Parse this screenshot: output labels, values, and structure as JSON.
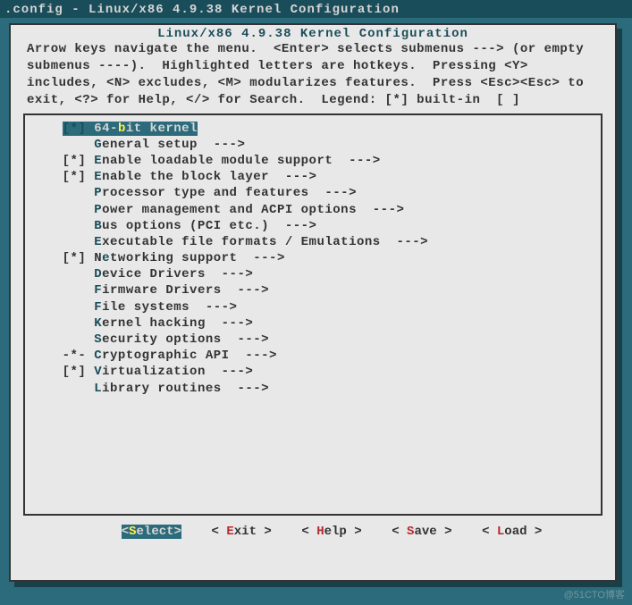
{
  "titlebar": ".config - Linux/x86 4.9.38 Kernel Configuration",
  "dialogTitle": "Linux/x86 4.9.38 Kernel Configuration",
  "help": {
    "l1": "Arrow keys navigate the menu.  <Enter> selects submenus ---> (or empty",
    "l2": "submenus ----).  Highlighted letters are hotkeys.  Pressing <Y>",
    "l3": "includes, <N> excludes, <M> modularizes features.  Press <Esc><Esc> to",
    "l4": "exit, <?> for Help, </> for Search.  Legend: [*] built-in  [ ]"
  },
  "menu": {
    "items": [
      {
        "marker": "[*]",
        "pre": "64-",
        "hot": "b",
        "post": "it kernel",
        "arrow": "",
        "selected": true
      },
      {
        "marker": "   ",
        "pre": "",
        "hot": "G",
        "post": "eneral setup  --->",
        "arrow": "",
        "selected": false
      },
      {
        "marker": "[*]",
        "pre": "",
        "hot": "E",
        "post": "nable loadable module support  --->",
        "arrow": "",
        "selected": false
      },
      {
        "marker": "[*]",
        "pre": "",
        "hot": "E",
        "post": "nable the block layer  --->",
        "arrow": "",
        "selected": false
      },
      {
        "marker": "   ",
        "pre": "",
        "hot": "P",
        "post": "rocessor type and features  --->",
        "arrow": "",
        "selected": false
      },
      {
        "marker": "   ",
        "pre": "",
        "hot": "P",
        "post": "ower management and ACPI options  --->",
        "arrow": "",
        "selected": false
      },
      {
        "marker": "   ",
        "pre": "",
        "hot": "B",
        "post": "us options (PCI etc.)  --->",
        "arrow": "",
        "selected": false
      },
      {
        "marker": "   ",
        "pre": "",
        "hot": "E",
        "post": "xecutable file formats / Emulations  --->",
        "arrow": "",
        "selected": false
      },
      {
        "marker": "[*]",
        "pre": "N",
        "hot": "e",
        "post": "tworking support  --->",
        "arrow": "",
        "selected": false
      },
      {
        "marker": "   ",
        "pre": "",
        "hot": "D",
        "post": "evice Drivers  --->",
        "arrow": "",
        "selected": false
      },
      {
        "marker": "   ",
        "pre": "",
        "hot": "F",
        "post": "irmware Drivers  --->",
        "arrow": "",
        "selected": false
      },
      {
        "marker": "   ",
        "pre": "",
        "hot": "F",
        "post": "ile systems  --->",
        "arrow": "",
        "selected": false
      },
      {
        "marker": "   ",
        "pre": "",
        "hot": "K",
        "post": "ernel hacking  --->",
        "arrow": "",
        "selected": false
      },
      {
        "marker": "   ",
        "pre": "",
        "hot": "S",
        "post": "ecurity options  --->",
        "arrow": "",
        "selected": false
      },
      {
        "marker": "-*-",
        "pre": "",
        "hot": "C",
        "post": "ryptographic API  --->",
        "arrow": "",
        "selected": false
      },
      {
        "marker": "[*]",
        "pre": "",
        "hot": "V",
        "post": "irtualization  --->",
        "arrow": "",
        "selected": false
      },
      {
        "marker": "   ",
        "pre": "",
        "hot": "L",
        "post": "ibrary routines  --->",
        "arrow": "",
        "selected": false
      }
    ]
  },
  "buttons": {
    "select": {
      "open": "<",
      "hot": "S",
      "rest": "elect",
      "close": ">",
      "selected": true
    },
    "exit": {
      "open": "< ",
      "hot": "E",
      "rest": "xit ",
      "close": ">",
      "selected": false
    },
    "help": {
      "open": "< ",
      "hot": "H",
      "rest": "elp ",
      "close": ">",
      "selected": false
    },
    "save": {
      "open": "< ",
      "hot": "S",
      "rest": "ave ",
      "close": ">",
      "selected": false
    },
    "load": {
      "open": "< ",
      "hot": "L",
      "rest": "oad ",
      "close": ">",
      "selected": false
    }
  },
  "watermark": "@51CTO博客"
}
